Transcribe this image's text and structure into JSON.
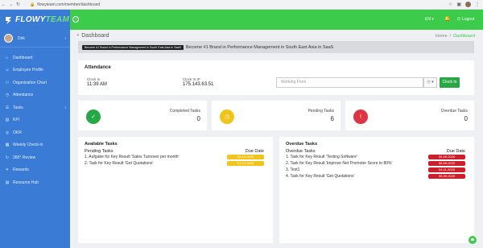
{
  "browser": {
    "url": "flowyteam.com/member/dashboard",
    "back_icon": "arrow-left-icon",
    "forward_icon": "arrow-right-icon",
    "reload_icon": "reload-icon"
  },
  "brand": {
    "name_part1": "FLOWY",
    "name_part2": "TEAM"
  },
  "user": {
    "name": "Dirk"
  },
  "sidebar": {
    "items": [
      {
        "label": "Dashboard",
        "icon": "home-icon",
        "glyph": "⌂",
        "has_children": false
      },
      {
        "label": "Employee Profile",
        "icon": "user-icon",
        "glyph": "☺",
        "has_children": false
      },
      {
        "label": "Organization Chart",
        "icon": "org-chart-icon",
        "glyph": "⚇",
        "has_children": false
      },
      {
        "label": "Attendance",
        "icon": "clock-icon",
        "glyph": "◷",
        "has_children": false
      },
      {
        "label": "Tasks",
        "icon": "tasks-icon",
        "glyph": "☰",
        "has_children": true
      },
      {
        "label": "KPI",
        "icon": "chart-icon",
        "glyph": "▥",
        "has_children": false
      },
      {
        "label": "OKR",
        "icon": "target-icon",
        "glyph": "◎",
        "has_children": false
      },
      {
        "label": "Weekly Check-in",
        "icon": "calendar-icon",
        "glyph": "▦",
        "has_children": false
      },
      {
        "label": "360° Review",
        "icon": "review-icon",
        "glyph": "↻",
        "has_children": false
      },
      {
        "label": "Rewards",
        "icon": "gift-icon",
        "glyph": "✦",
        "has_children": false
      },
      {
        "label": "Resource Hub",
        "icon": "folder-icon",
        "glyph": "▤",
        "has_children": false
      }
    ]
  },
  "topbar": {
    "lang": "EN",
    "logout_label": "Logout"
  },
  "page": {
    "title": "Dashboard",
    "breadcrumb_home": "Home",
    "breadcrumb_sep": "/",
    "breadcrumb_current": "Dashboard"
  },
  "banner": {
    "image_text": "Become #1 Brand in Performance Management in South East Asia in SaaS",
    "text": "Become #1 Brand in Performance Management in South East Asia in SaaS"
  },
  "attendance": {
    "title": "Attendance",
    "clock_in_label": "Clock In",
    "clock_in_value": "11:39 AM",
    "clock_ip_label": "Clock In IP",
    "clock_ip_value": "175.143.63.51",
    "working_from_placeholder": "Working From",
    "clock_in_button": "Clock In"
  },
  "stats": {
    "completed": {
      "label": "Completed Tasks",
      "value": "0",
      "color": "#28a745",
      "icon": "check-circle-icon"
    },
    "pending": {
      "label": "Pending Tasks",
      "value": "6",
      "color": "#f0c419",
      "icon": "clock-icon"
    },
    "overdue": {
      "label": "Overdue Tasks",
      "value": "0",
      "color": "#dc3545",
      "icon": "alert-icon"
    }
  },
  "available_tasks": {
    "title": "Available Tasks",
    "subheading": "Pending Tasks",
    "due_label": "Due Date",
    "items": [
      {
        "text": "1. Aufgabe für Key Result 'Sales Turnover per month'",
        "date": "30-12-2020"
      },
      {
        "text": "2. Task for Key Result 'Get Quotations'",
        "date": "01-10-2020"
      }
    ]
  },
  "overdue_tasks": {
    "title": "Overdue Tasks",
    "subheading": "Overdue Tasks",
    "due_label": "Due Date",
    "items": [
      {
        "text": "1. Task for Key Result 'Testing Software'",
        "date": "30-09-2020"
      },
      {
        "text": "2. Task for Key Result 'Improve Net Promoter Score to 80%'",
        "date": "30-09-2020"
      },
      {
        "text": "3. Test1",
        "date": "04-11-2020"
      },
      {
        "text": "4. Task for Key Result 'Get Quotations'",
        "date": "30-09-2020"
      }
    ]
  },
  "colors": {
    "sidebar": "#3a7bd5",
    "topbar": "#3ccb4a",
    "accent_green": "#28a745",
    "badge_yellow": "#f0c419",
    "badge_red": "#cc1f2b"
  }
}
